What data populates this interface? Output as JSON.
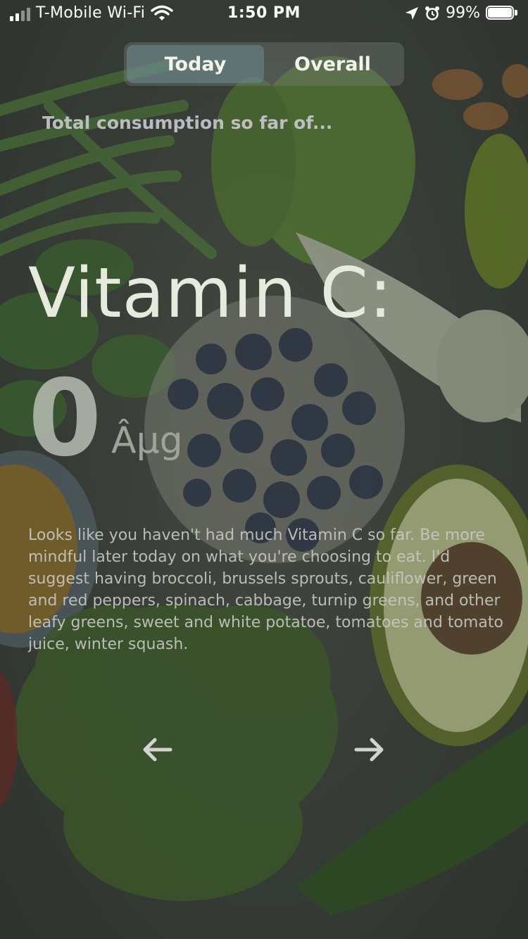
{
  "status_bar": {
    "carrier": "T-Mobile Wi-Fi",
    "time": "1:50 PM",
    "battery": "99%"
  },
  "tabs": [
    {
      "label": "Today",
      "active": true
    },
    {
      "label": "Overall",
      "active": false
    }
  ],
  "subtitle": "Total consumption so far of...",
  "nutrient": {
    "name": "Vitamin C:",
    "amount": "0",
    "unit": "Âµg"
  },
  "advice": "Looks like you haven't had much Vitamin C so far. Be more mindful later today on what you're choosing to eat. I'd suggest having broccoli, brussels sprouts, cauliflower, green and red peppers, spinach, cabbage, turnip greens, and other leafy greens, sweet and white potatoe, tomatoes and tomato juice, winter squash.",
  "icons": {
    "prev": "arrow-left-icon",
    "next": "arrow-right-icon"
  },
  "colors": {
    "text_primary": "#e6ebde",
    "active_tab": "#6e8c91"
  }
}
